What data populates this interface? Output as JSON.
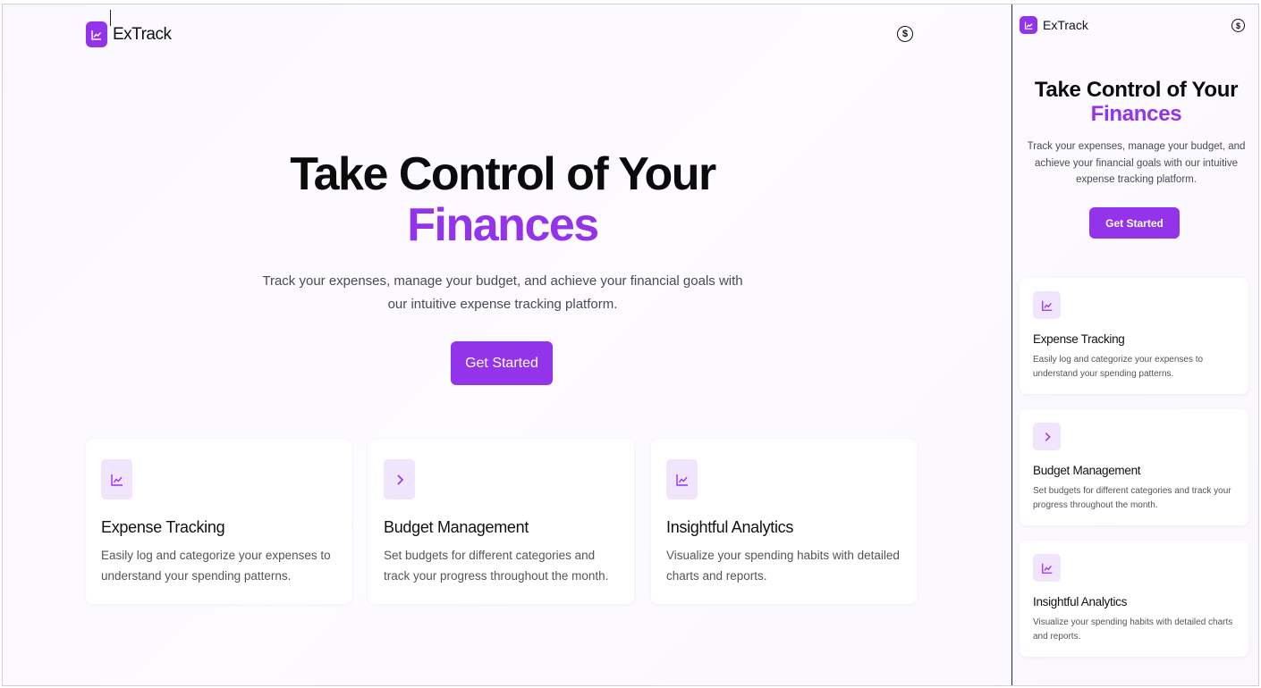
{
  "app": {
    "name": "ExTrack",
    "icons": {
      "logo": "chart-line-icon",
      "currency": "dollar-circle-icon"
    }
  },
  "colors": {
    "accent": "#9333ea",
    "accent_soft": "#f1e4fd",
    "background": "#fbf7ff",
    "text": "#111111"
  },
  "hero": {
    "title_line1": "Take Control of Your",
    "title_line2": "Finances",
    "subtitle": "Track your expenses, manage your budget, and achieve your financial goals with our intuitive expense tracking platform.",
    "cta_label": "Get Started"
  },
  "features": [
    {
      "icon": "chart-line-icon",
      "title": "Expense Tracking",
      "description": "Easily log and categorize your expenses to understand your spending patterns."
    },
    {
      "icon": "chevron-right-icon",
      "title": "Budget Management",
      "description": "Set budgets for different categories and track your progress throughout the month."
    },
    {
      "icon": "chart-line-icon",
      "title": "Insightful Analytics",
      "description": "Visualize your spending habits with detailed charts and reports."
    }
  ]
}
